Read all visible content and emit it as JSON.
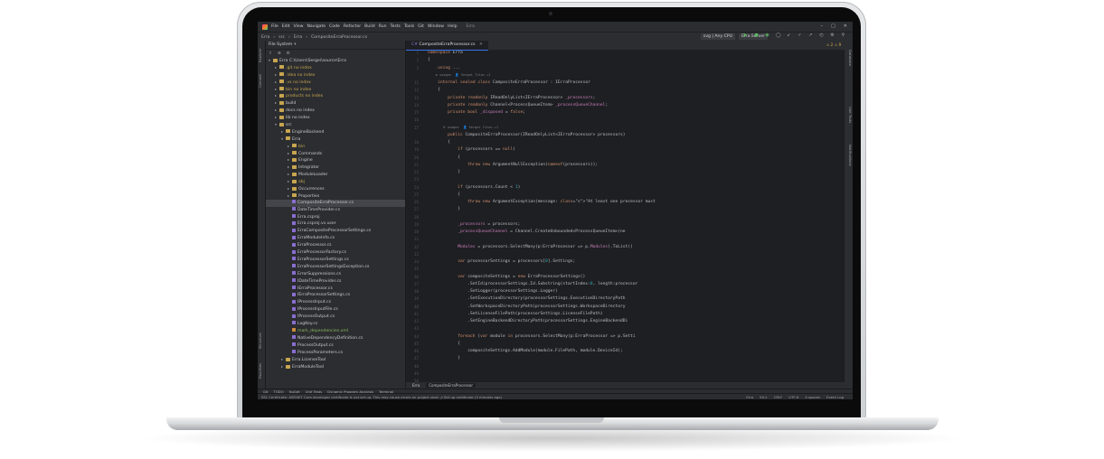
{
  "menu": [
    "File",
    "Edit",
    "View",
    "Navigate",
    "Code",
    "Refactor",
    "Build",
    "Run",
    "Tests",
    "Tools",
    "Git",
    "Window",
    "Help"
  ],
  "window_title": "Erra",
  "breadcrumb": [
    "Erra",
    "src",
    "Erra",
    "CompositeErraProcessor.cs"
  ],
  "run_config": "svg | Any CPU",
  "run_target": "Erra.Server",
  "project_panel": {
    "title": "File System",
    "tree": [
      {
        "label": "Erra  C:\\Users\\Sergei\\source\\Erra",
        "indent": 0,
        "icon": "folder",
        "open": true
      },
      {
        "label": ".git  no index",
        "indent": 1,
        "icon": "folder",
        "muted": true
      },
      {
        "label": ".idea  no index",
        "indent": 1,
        "icon": "folder",
        "muted": true
      },
      {
        "label": ".vs  no index",
        "indent": 1,
        "icon": "folder",
        "muted": true
      },
      {
        "label": "bin  no index",
        "indent": 1,
        "icon": "folder",
        "muted": true
      },
      {
        "label": "products  no index",
        "indent": 1,
        "icon": "folder",
        "muted": true
      },
      {
        "label": "build",
        "indent": 1,
        "icon": "folder"
      },
      {
        "label": "docs  no index",
        "indent": 1,
        "icon": "folder"
      },
      {
        "label": "lib  no index",
        "indent": 1,
        "icon": "folder"
      },
      {
        "label": "src",
        "indent": 1,
        "icon": "folder",
        "open": true
      },
      {
        "label": "EngineBackend",
        "indent": 2,
        "icon": "folder"
      },
      {
        "label": "Erra",
        "indent": 2,
        "icon": "folder",
        "open": true
      },
      {
        "label": "bin",
        "indent": 3,
        "icon": "folder",
        "muted": true
      },
      {
        "label": "Commands",
        "indent": 3,
        "icon": "folder"
      },
      {
        "label": "Engine",
        "indent": 3,
        "icon": "folder"
      },
      {
        "label": "Integrator",
        "indent": 3,
        "icon": "folder"
      },
      {
        "label": "ModuleLoader",
        "indent": 3,
        "icon": "folder"
      },
      {
        "label": "obj",
        "indent": 3,
        "icon": "folder",
        "muted": true
      },
      {
        "label": "Occurrences",
        "indent": 3,
        "icon": "folder"
      },
      {
        "label": "Properties",
        "indent": 3,
        "icon": "folder"
      },
      {
        "label": "CompositeErraProcessor.cs",
        "indent": 3,
        "icon": "file",
        "selected": true
      },
      {
        "label": "DateTimeProvider.cs",
        "indent": 3,
        "icon": "file"
      },
      {
        "label": "Erra.csproj",
        "indent": 3,
        "icon": "file"
      },
      {
        "label": "Erra.csproj.vs.user",
        "indent": 3,
        "icon": "file"
      },
      {
        "label": "ErraCompositeProcessorSettings.cs",
        "indent": 3,
        "icon": "file"
      },
      {
        "label": "ErraModuleInfo.cs",
        "indent": 3,
        "icon": "file"
      },
      {
        "label": "ErraProcessor.cs",
        "indent": 3,
        "icon": "file"
      },
      {
        "label": "ErraProcessorFactory.cs",
        "indent": 3,
        "icon": "file"
      },
      {
        "label": "ErraProcessorSettings.cs",
        "indent": 3,
        "icon": "file"
      },
      {
        "label": "ErraProcessorSettingsException.cs",
        "indent": 3,
        "icon": "file"
      },
      {
        "label": "ErrorSuppressions.cs",
        "indent": 3,
        "icon": "file"
      },
      {
        "label": "IDateTimeProvider.cs",
        "indent": 3,
        "icon": "file"
      },
      {
        "label": "IErraProcessor.cs",
        "indent": 3,
        "icon": "file"
      },
      {
        "label": "IErraProcessorSettings.cs",
        "indent": 3,
        "icon": "file"
      },
      {
        "label": "IProcessInput.cs",
        "indent": 3,
        "icon": "file"
      },
      {
        "label": "IProcessInputFile.cs",
        "indent": 3,
        "icon": "file"
      },
      {
        "label": "IProcessOutput.cs",
        "indent": 3,
        "icon": "file"
      },
      {
        "label": "LogKey.cs",
        "indent": 3,
        "icon": "file"
      },
      {
        "label": "mark_dependencies.xml",
        "indent": 3,
        "icon": "xml",
        "green": true
      },
      {
        "label": "NativeDependencyDefinition.cs",
        "indent": 3,
        "icon": "file"
      },
      {
        "label": "ProcessOutput.cs",
        "indent": 3,
        "icon": "file"
      },
      {
        "label": "ProcessParameters.cs",
        "indent": 3,
        "icon": "file"
      },
      {
        "label": "Erra.LicenseTool",
        "indent": 2,
        "icon": "folder"
      },
      {
        "label": "ErraModuleTool",
        "indent": 2,
        "icon": "folder"
      }
    ]
  },
  "editor": {
    "tab": "CompositeErraProcessor.cs",
    "problems": "⚠ 2  ⚠ 9",
    "line_numbers": [
      "1",
      "2",
      "3",
      "",
      "11",
      "12",
      "13",
      "14",
      "15",
      "16",
      "17",
      "",
      "18",
      "19",
      "20",
      "21",
      "22",
      "23",
      "24",
      "25",
      "26",
      "27",
      "28",
      "29",
      "30",
      "31",
      "32",
      "33",
      "34",
      "35",
      "36",
      "37",
      "38",
      "39",
      "40",
      "41",
      "42",
      "43",
      "44",
      "45",
      "46",
      "47",
      "48",
      "49",
      "50"
    ]
  },
  "code_lines": [
    "namespace Erra",
    "{",
    "    using ...",
    "    ⚙ usages  👤 Sergei Titov +1",
    "    internal sealed class CompositeErraProcessor : IErraProcessor",
    "    {",
    "        private readonly IReadOnlyList<IErraProcessor> _processors;",
    "        private readonly Channel<ProcessQueueItem> _processQueueChannel;",
    "        private bool _disposed = false;",
    "",
    "        0 usages  👤 Sergei Titov +1",
    "        public CompositeErraProcessor(IReadOnlyList<IErraProcessor> processors)",
    "        {",
    "            if (processors == null)",
    "            {",
    "                throw new ArgumentNullException(nameof(processors));",
    "            }",
    "",
    "            if (processors.Count < 1)",
    "            {",
    "                throw new ArgumentException(message: \"At least one processor must",
    "            }",
    "",
    "            _processors = processors;",
    "            _processQueueChannel = Channel.CreateUnbounded<ProcessQueueItem>(ne",
    "",
    "            Modules = processors.SelectMany(p:ErraProcessor => p.Modules).ToList()",
    "",
    "            var processorSettings = processors[0].Settings;",
    "",
    "            var compositeSettings = new ErraProcessorSettings()",
    "                .SetId(processorSettings.Id.Substring(startIndex:0, length:processor",
    "                .SetLogger(processorSettings.Logger)",
    "                .SetExecutionDirectory(processorSettings.ExecutionDirectoryPath",
    "                .SetWorkspaceDirectoryPath(processorSettings.WorkspaceDirectory",
    "                .SetLicenseFilePath(processorSettings.LicenseFilePath)",
    "                .SetEngineBackendDirectoryPath(processorSettings.EngineBackendDi",
    "",
    "            foreach (var module in processors.SelectMany(p:ErraProcessor => p.Setti",
    "            {",
    "                compositeSettings.AddModule(module.FilePath, module.DeviceId);",
    "            }"
  ],
  "bottom_file_tabs": [
    "Erra",
    "CompositeErraProcessor"
  ],
  "tool_windows": [
    "Git",
    "TODO",
    "NuGet",
    "Unit Tests",
    "Dynamic Program Analysis",
    "Terminal"
  ],
  "status_message": "SSL Certificate: ASP.NET Core developer certificate is not set up. This may cause errors on project start. // Set up certificate (3 minutes ago)",
  "status_right": [
    "Erra",
    "50:1",
    "CRLF",
    "UTF-8",
    "4 spaces",
    "Event Log"
  ],
  "left_strip_labels": [
    "Explorer",
    "Commit",
    "Structure",
    "Favorites"
  ],
  "right_strip_labels": [
    "Database",
    "Unit Tests",
    "Notifications"
  ],
  "colors": {
    "accent": "#3574f0",
    "ide_bg": "#1e1f22",
    "panel_bg": "#2b2d30"
  }
}
